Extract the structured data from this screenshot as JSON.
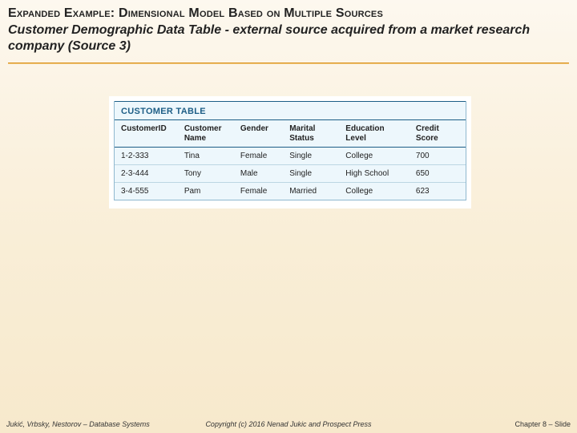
{
  "header": {
    "title": "Expanded Example: Dimensional Model Based on Multiple Sources",
    "subtitle": "Customer Demographic Data Table  - external source acquired from a market research company (Source 3)"
  },
  "table": {
    "caption": "CUSTOMER TABLE",
    "columns": [
      "CustomerID",
      "Customer Name",
      "Gender",
      "Marital Status",
      "Education Level",
      "Credit Score"
    ],
    "rows": [
      {
        "id": "1-2-333",
        "name": "Tina",
        "gender": "Female",
        "marital": "Single",
        "education": "College",
        "score": "700"
      },
      {
        "id": "2-3-444",
        "name": "Tony",
        "gender": "Male",
        "marital": "Single",
        "education": "High School",
        "score": "650"
      },
      {
        "id": "3-4-555",
        "name": "Pam",
        "gender": "Female",
        "marital": "Married",
        "education": "College",
        "score": "623"
      }
    ]
  },
  "footer": {
    "left": "Jukić, Vrbsky, Nestorov – Database Systems",
    "center": "Copyright (c) 2016 Nenad Jukic and Prospect Press",
    "right": "Chapter 8 – Slide"
  }
}
